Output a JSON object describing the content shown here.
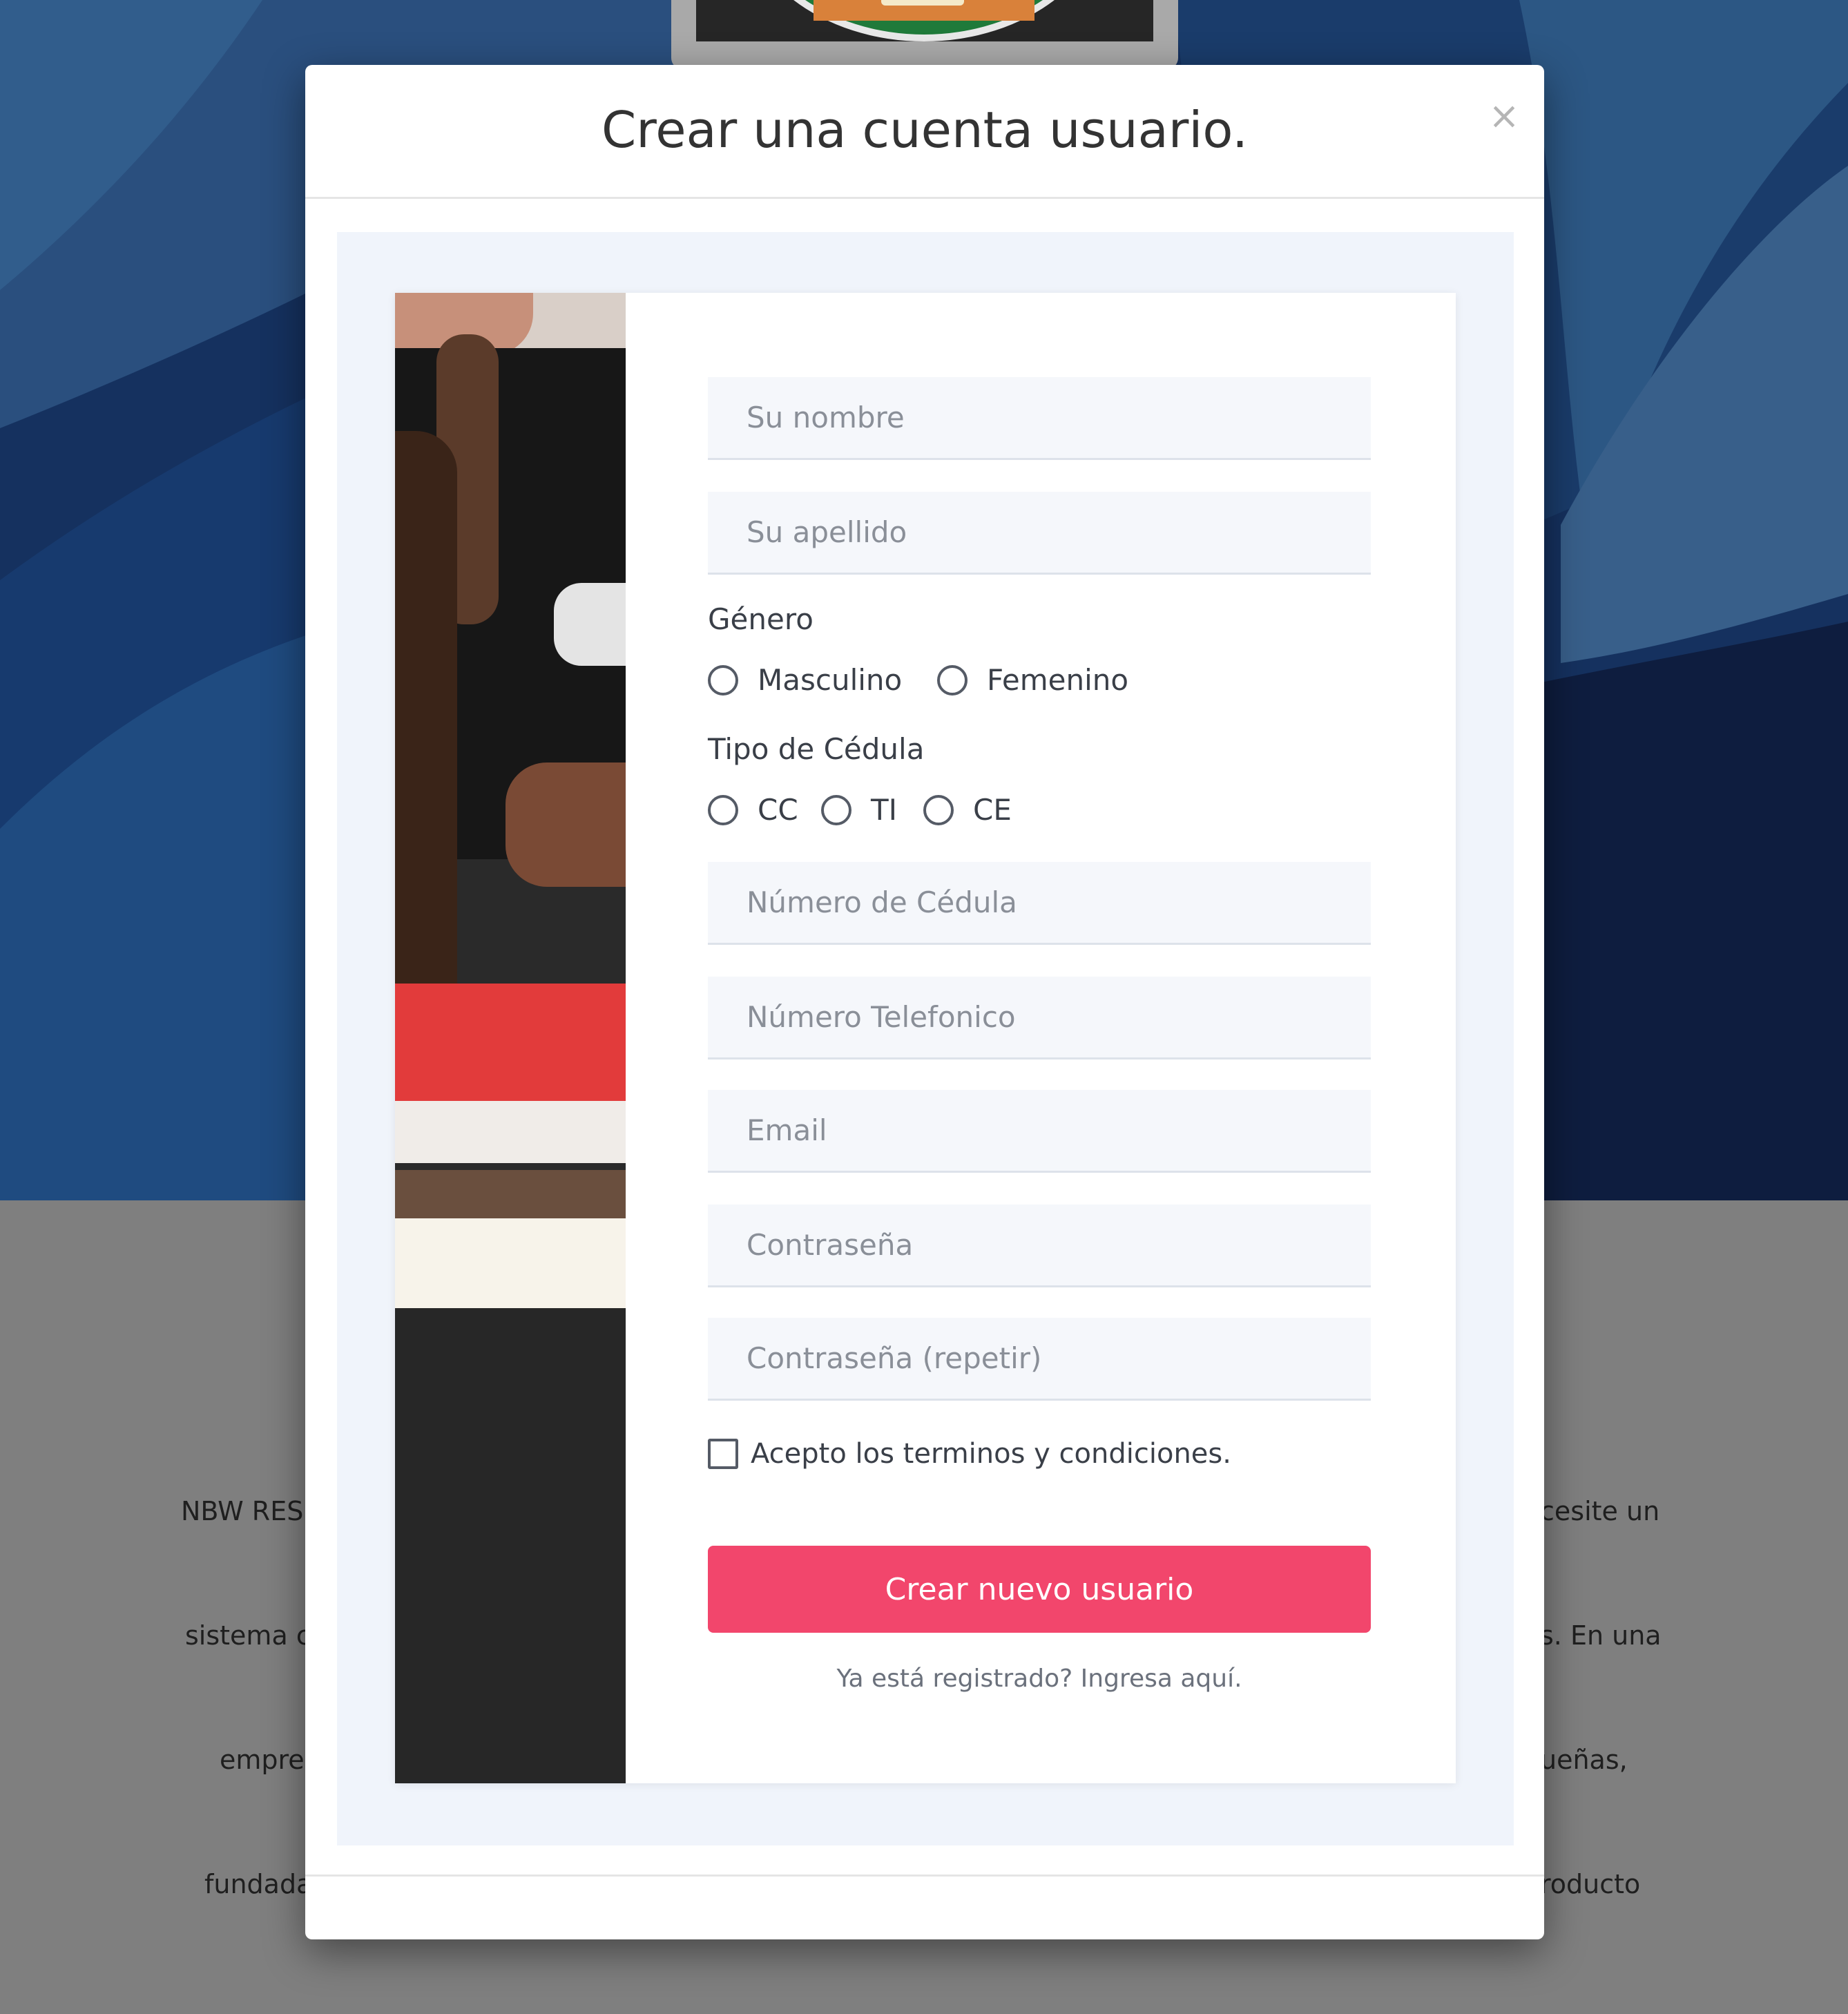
{
  "modal": {
    "title": "Crear una cuenta usuario.",
    "close_glyph": "×",
    "close_icon": "close-icon"
  },
  "form": {
    "first_name_placeholder": "Su nombre",
    "last_name_placeholder": "Su apellido",
    "gender": {
      "label": "Género",
      "options": [
        "Masculino",
        "Femenino"
      ]
    },
    "id_type": {
      "label": "Tipo de Cédula",
      "options": [
        "CC",
        "TI",
        "CE"
      ]
    },
    "id_number_placeholder": "Número de Cédula",
    "phone_placeholder": "Número Telefonico",
    "email_placeholder": "Email",
    "password_placeholder": "Contraseña",
    "password_repeat_placeholder": "Contraseña (repetir)",
    "terms_label": "Acepto los terminos y condiciones.",
    "submit_label": "Crear nuevo usuario",
    "login_link": "Ya está registrado? Ingresa aquí."
  },
  "background": {
    "left_text_lines": [
      "NBW RES",
      "sistema c",
      "empre",
      "fundada"
    ],
    "right_text_lines": [
      "cesite un",
      "s. En una",
      "ueñas,",
      "roducto"
    ]
  },
  "colors": {
    "accent": "#f2466c",
    "hero_blue": "#132a55",
    "modal_body_bg": "#f0f4fb"
  }
}
